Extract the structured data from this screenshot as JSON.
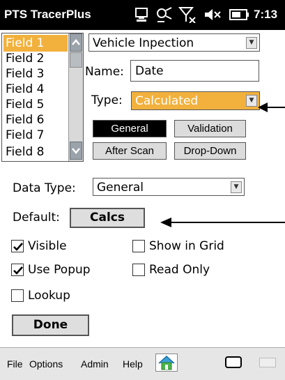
{
  "status_bar": {
    "app_title": "PTS TracerPlus",
    "clock": "7:13",
    "icons": [
      "sync-icon",
      "connectivity-icon",
      "no-signal-icon",
      "volume-muted-icon",
      "battery-icon"
    ]
  },
  "field_list": {
    "items": [
      "Field 1",
      "Field 2",
      "Field 3",
      "Field 4",
      "Field 5",
      "Field 6",
      "Field 7",
      "Field 8"
    ],
    "selected_index": 0
  },
  "form_combo": {
    "value": "Vehicle Inpection"
  },
  "name": {
    "label": "Name:",
    "value": "Date"
  },
  "type": {
    "label": "Type:",
    "value": "Calculated"
  },
  "tabs": {
    "general": "General",
    "validation": "Validation",
    "after_scan": "After Scan",
    "drop_down": "Drop-Down"
  },
  "data_type": {
    "label": "Data Type:",
    "value": "General"
  },
  "default": {
    "label": "Default:",
    "button": "Calcs"
  },
  "checkboxes": {
    "visible": {
      "label": "Visible",
      "checked": true
    },
    "show_in_grid": {
      "label": "Show in Grid",
      "checked": false
    },
    "use_popup": {
      "label": "Use Popup",
      "checked": true
    },
    "read_only": {
      "label": "Read Only",
      "checked": false
    },
    "lookup": {
      "label": "Lookup",
      "checked": false
    }
  },
  "done_button": "Done",
  "menu": {
    "file": "File",
    "options": "Options",
    "admin": "Admin",
    "help": "Help"
  },
  "colors": {
    "selection": "#f2b13d",
    "title_bar": "#000000",
    "active_tab": "#000000"
  }
}
